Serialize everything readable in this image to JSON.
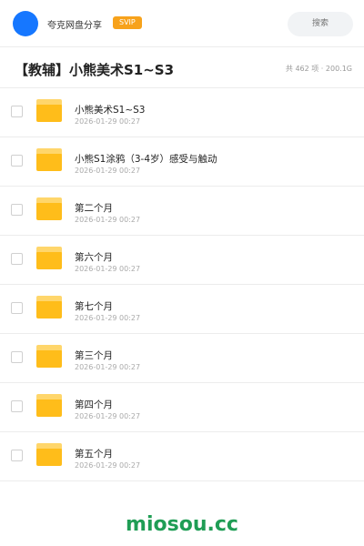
{
  "header": {
    "app_title": "夸克网盘分享",
    "badge": "SVIP",
    "search_placeholder": "搜索"
  },
  "folder": {
    "title": "【教辅】小熊美术S1~S3",
    "meta": "共 462 项 · 200.1G"
  },
  "items": [
    {
      "name": "小熊美术S1~S3",
      "date": "2026-01-29 00:27"
    },
    {
      "name": "小熊S1涂鸦（3-4岁）感受与触动",
      "date": "2026-01-29 00:27"
    },
    {
      "name": "第二个月",
      "date": "2026-01-29 00:27"
    },
    {
      "name": "第六个月",
      "date": "2026-01-29 00:27"
    },
    {
      "name": "第七个月",
      "date": "2026-01-29 00:27"
    },
    {
      "name": "第三个月",
      "date": "2026-01-29 00:27"
    },
    {
      "name": "第四个月",
      "date": "2026-01-29 00:27"
    },
    {
      "name": "第五个月",
      "date": "2026-01-29 00:27"
    }
  ],
  "watermark": "miosou.cc",
  "colors": {
    "avatar": "#1677ff",
    "badge": "#f7a21b",
    "folder_front": "#ffbd1a",
    "folder_back": "#ffd66b",
    "watermark": "#1f9d55"
  },
  "icons": {
    "folder": "folder-icon",
    "checkbox": "checkbox-icon"
  }
}
